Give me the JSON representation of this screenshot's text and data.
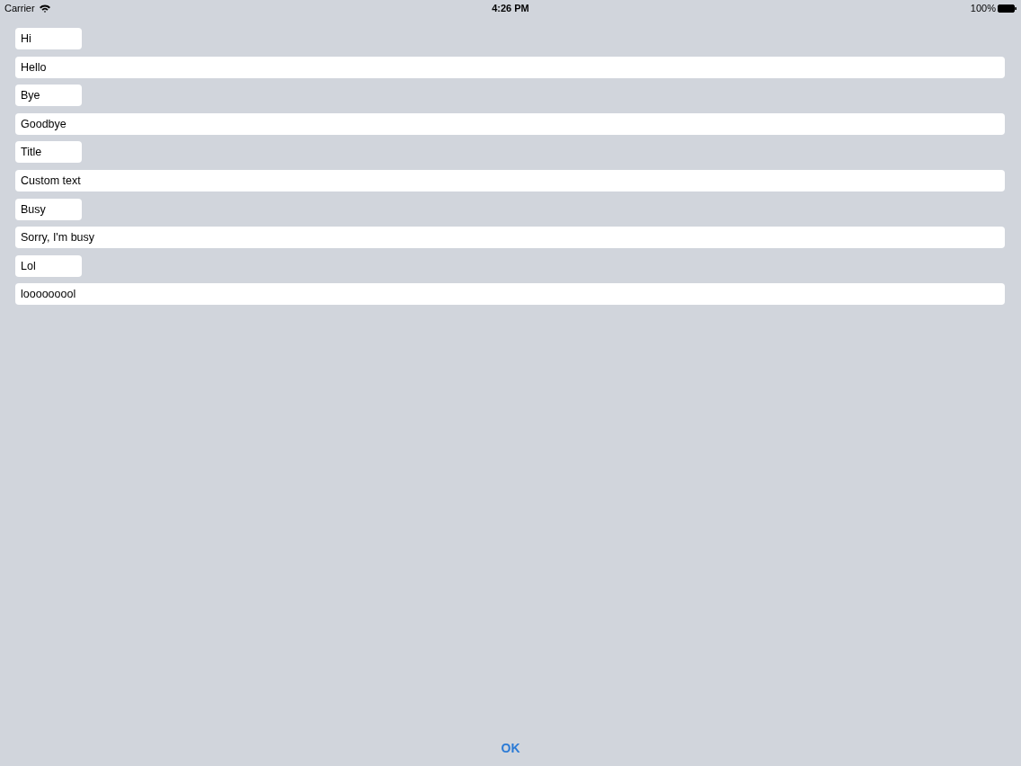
{
  "status_bar": {
    "carrier": "Carrier",
    "time": "4:26 PM",
    "battery": "100%"
  },
  "entries": [
    {
      "title": "Hi",
      "text": "Hello"
    },
    {
      "title": "Bye",
      "text": "Goodbye"
    },
    {
      "title": "Title",
      "text": "Custom text"
    },
    {
      "title": "Busy",
      "text": "Sorry, I'm busy"
    },
    {
      "title": "Lol",
      "text": "looooooool"
    }
  ],
  "ok_button": {
    "label": "OK"
  }
}
